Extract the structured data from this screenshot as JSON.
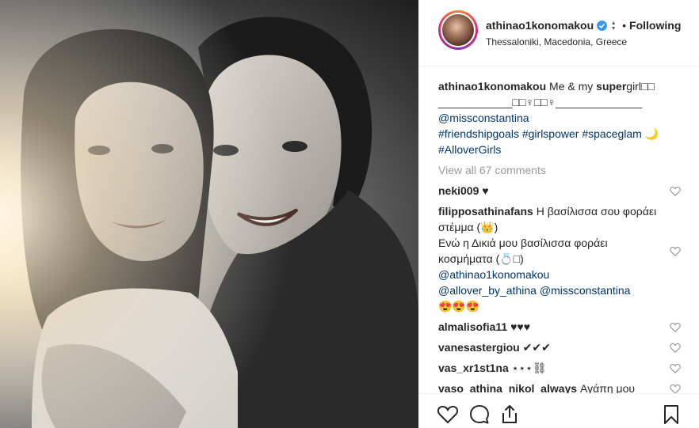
{
  "header": {
    "username": "athinao1konomakou",
    "follow_dot": "•",
    "follow_status": "Following",
    "location": "Thessaloniki, Macedonia, Greece"
  },
  "caption": {
    "username": "athinao1konomakou",
    "text_before": "Me & my ",
    "text_bold": "super",
    "text_after": "girl□□ ____________□□♀□□♀______________",
    "mention": "@missconstantina",
    "hashtags_line": "#friendshipgoals #girlspower #spaceglam",
    "moon": "🌙",
    "hashtag2": "#AlloverGirls"
  },
  "view_all_comments": "View all 67 comments",
  "comments": [
    {
      "username": "neki009",
      "text": "♥"
    },
    {
      "username": "filipposathinafans",
      "text1": "Η βασίλισσα σου φοράει στέμμα (👑)",
      "text2": "Ενώ η Δικιά μου βασίλισσα φοράει κοσμήματα (💍□)",
      "mention1": "@athinao1konomakou",
      "mention2": "@allover_by_athina",
      "mention3": "@missconstantina",
      "emoji": "😍😍😍"
    },
    {
      "username": "almalisofia11",
      "text": "♥♥♥"
    },
    {
      "username": "vanesastergiou",
      "text": "✔✔✔"
    },
    {
      "username": "vas_xr1st1na",
      "text": "⋆⋆⋆⛓"
    },
    {
      "username": "vaso_athina_nikol_always",
      "text": "Αγάπη μου"
    }
  ],
  "colors": {
    "text": "#262626",
    "link": "#003569",
    "muted": "#999999",
    "verified": "#3897f0",
    "divider": "#efefef"
  },
  "icons": [
    "verified-badge-icon",
    "heart-icon",
    "comment-icon",
    "share-icon",
    "bookmark-icon"
  ]
}
